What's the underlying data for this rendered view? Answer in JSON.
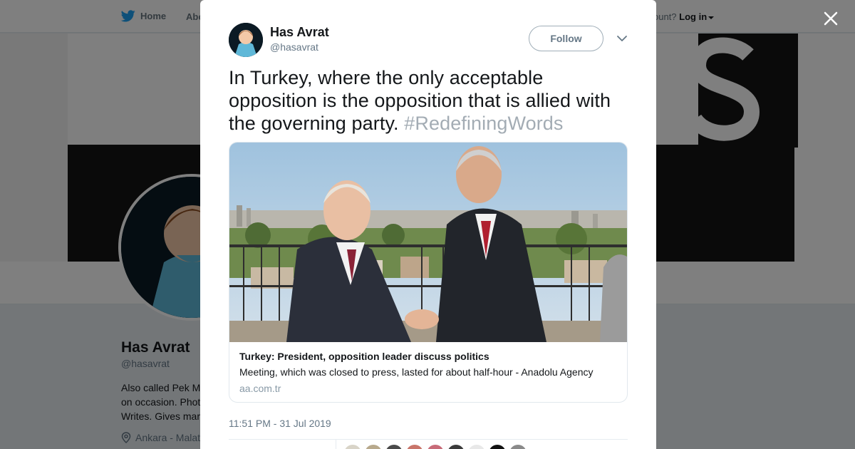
{
  "nav": {
    "home_label": "Home",
    "about_label": "Abo",
    "login_prefix": "ccount?",
    "login_label": "Log in"
  },
  "profile": {
    "name": "Has Avrat",
    "handle": "@hasavrat",
    "bio_lines": [
      "Also called Pek M",
      "on occasion. Phot",
      "Writes. Gives mar"
    ],
    "location": "Ankara - Malat"
  },
  "tweet": {
    "author_name": "Has Avrat",
    "author_handle": "@hasavrat",
    "follow_label": "Follow",
    "text": "In Turkey, where the only acceptable opposition is the opposition that is allied with the governing party.",
    "hashtag": "#RedefiningWords",
    "timestamp": "11:51 PM - 31 Jul 2019"
  },
  "card": {
    "title": "Turkey: President, opposition leader discuss politics",
    "description": "Meeting, which was closed to press, lasted for about half-hour - Anadolu Agency",
    "domain": "aa.com.tr"
  },
  "colors": {
    "twitter_blue": "#1da1f2",
    "hashtag": "#a3acb4",
    "overlay": "rgba(0,0,0,0.5)",
    "liker_avatars": [
      "#d9d4c8",
      "#b8a98c",
      "#4a4a4a",
      "#c9756a",
      "#c86b78",
      "#3b3b3b",
      "#e8e8e8",
      "#111111",
      "#8a8a8a"
    ]
  },
  "icons": {
    "close": "close-icon",
    "chevron": "chevron-down-icon",
    "bird": "twitter-bird-icon",
    "location": "location-pin-icon"
  }
}
